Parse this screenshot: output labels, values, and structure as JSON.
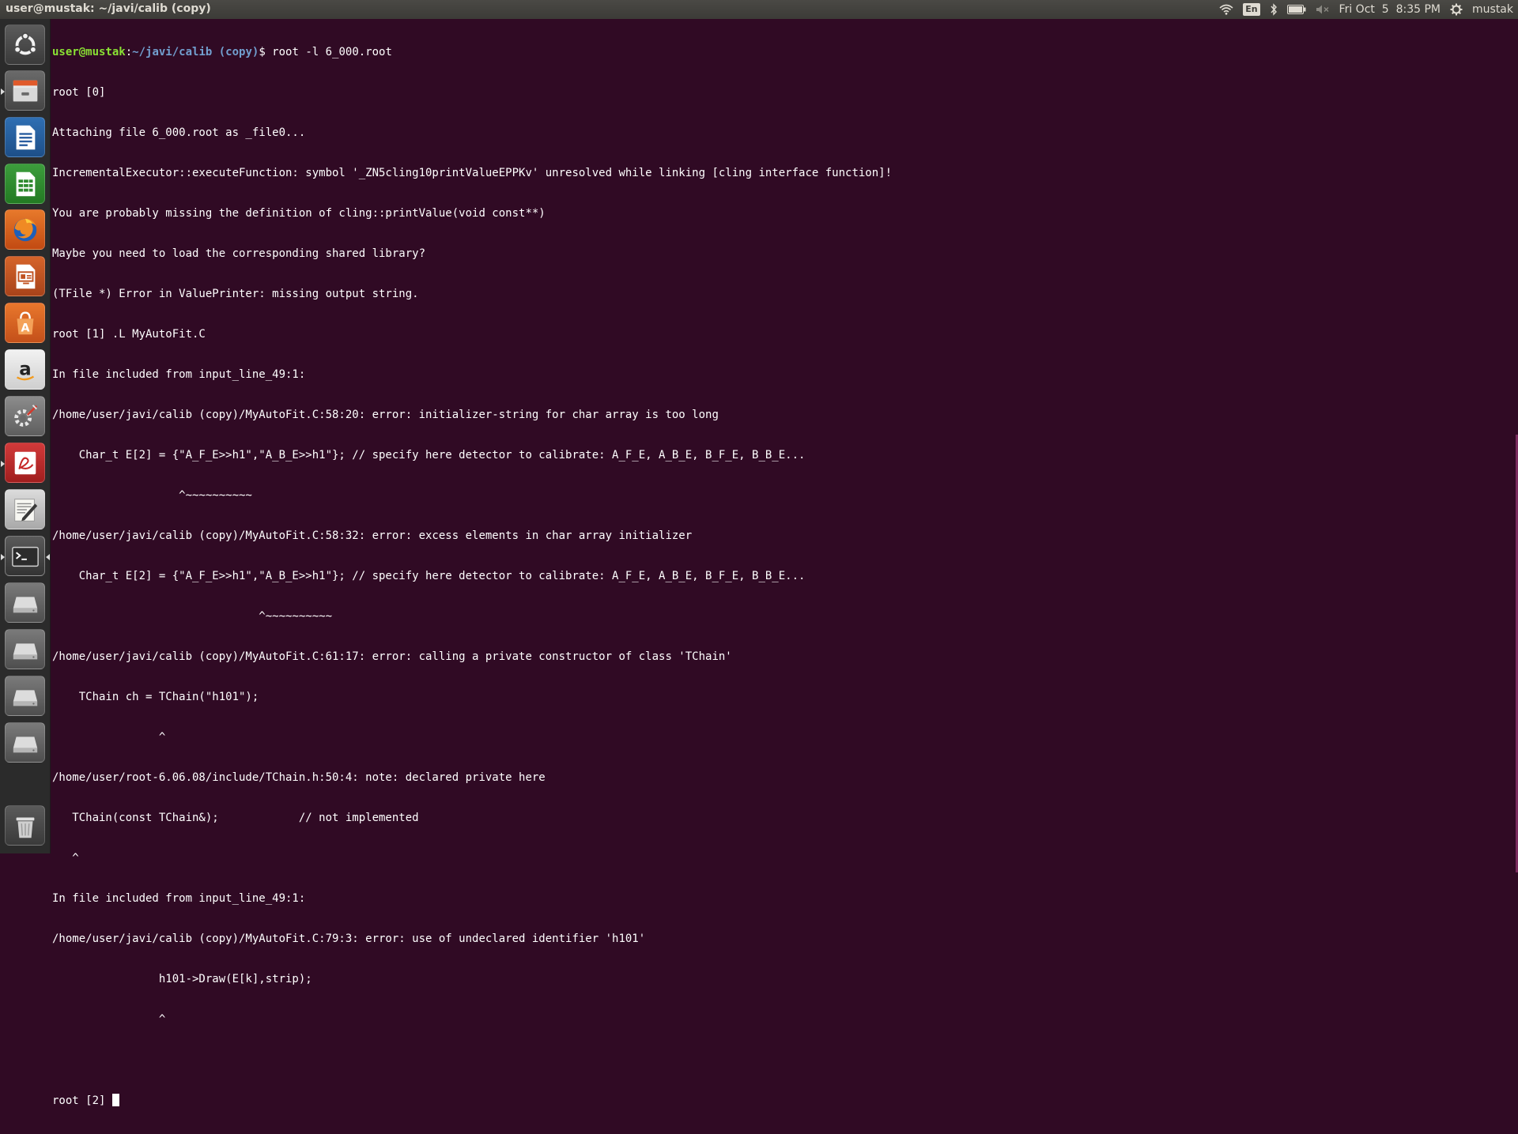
{
  "topbar": {
    "window_title": "user@mustak: ~/javi/calib (copy)",
    "keyboard_layout": "En",
    "clock": "Fri Oct  5  8:35 PM",
    "username": "mustak",
    "icons": [
      "wifi-icon",
      "keyboard-layout-indicator",
      "bluetooth-icon",
      "battery-icon",
      "volume-muted-icon",
      "gear-icon"
    ]
  },
  "launcher": {
    "items": [
      {
        "name": "ubuntu-dash-icon",
        "active": false
      },
      {
        "name": "files-icon",
        "active": false
      },
      {
        "name": "libreoffice-writer-icon",
        "active": false
      },
      {
        "name": "libreoffice-calc-icon",
        "active": false
      },
      {
        "name": "firefox-icon",
        "active": false
      },
      {
        "name": "libreoffice-impress-icon",
        "active": false
      },
      {
        "name": "ubuntu-software-icon",
        "active": false
      },
      {
        "name": "amazon-icon",
        "active": false
      },
      {
        "name": "system-settings-icon",
        "active": false
      },
      {
        "name": "document-viewer-icon",
        "active": false
      },
      {
        "name": "text-editor-icon",
        "active": false
      },
      {
        "name": "terminal-icon",
        "active": true
      },
      {
        "name": "drive-icon",
        "active": false
      },
      {
        "name": "drive-icon",
        "active": false
      },
      {
        "name": "drive-icon",
        "active": false
      },
      {
        "name": "drive-icon",
        "active": false
      },
      {
        "name": "trash-icon",
        "active": false
      }
    ]
  },
  "terminal": {
    "prompt_user": "user@mustak",
    "prompt_colon": ":",
    "prompt_path": "~/javi/calib (copy)",
    "prompt_symbol": "$",
    "command": " root -l 6_000.root",
    "lines": [
      "root [0]",
      "Attaching file 6_000.root as _file0...",
      "IncrementalExecutor::executeFunction: symbol '_ZN5cling10printValueEPPKv' unresolved while linking [cling interface function]!",
      "You are probably missing the definition of cling::printValue(void const**)",
      "Maybe you need to load the corresponding shared library?",
      "(TFile *) Error in ValuePrinter: missing output string.",
      "root [1] .L MyAutoFit.C",
      "In file included from input_line_49:1:",
      "/home/user/javi/calib (copy)/MyAutoFit.C:58:20: error: initializer-string for char array is too long",
      "    Char_t E[2] = {\"A_F_E>>h1\",\"A_B_E>>h1\"}; // specify here detector to calibrate: A_F_E, A_B_E, B_F_E, B_B_E...",
      "                   ^~~~~~~~~~~",
      "/home/user/javi/calib (copy)/MyAutoFit.C:58:32: error: excess elements in char array initializer",
      "    Char_t E[2] = {\"A_F_E>>h1\",\"A_B_E>>h1\"}; // specify here detector to calibrate: A_F_E, A_B_E, B_F_E, B_B_E...",
      "                               ^~~~~~~~~~~",
      "/home/user/javi/calib (copy)/MyAutoFit.C:61:17: error: calling a private constructor of class 'TChain'",
      "    TChain ch = TChain(\"h101\");",
      "                ^",
      "/home/user/root-6.06.08/include/TChain.h:50:4: note: declared private here",
      "   TChain(const TChain&);            // not implemented",
      "   ^",
      "In file included from input_line_49:1:",
      "/home/user/javi/calib (copy)/MyAutoFit.C:79:3: error: use of undeclared identifier 'h101'",
      "                h101->Draw(E[k],strip);",
      "                ^",
      ""
    ],
    "current_prompt": "root [2] "
  },
  "colors": {
    "terminal_bg": "#300a24",
    "terminal_fg": "#ffffff",
    "prompt_user": "#8ae234",
    "prompt_path": "#729fcf",
    "panel_bg": "#3c3b37",
    "launcher_bg": "#2b2b2b"
  }
}
